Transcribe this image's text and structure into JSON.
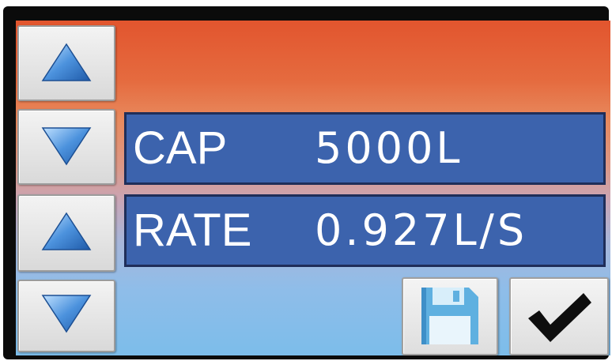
{
  "controls": {
    "up_icon": "triangle-up-icon",
    "down_icon": "triangle-down-icon",
    "save_icon": "floppy-disk-icon",
    "confirm_icon": "checkmark-icon"
  },
  "fields": [
    {
      "label": "CAP",
      "value": "5000L"
    },
    {
      "label": "RATE",
      "value": "0.927L/S"
    }
  ],
  "colors": {
    "field_bg": "#3c63ad",
    "field_text": "#ffffff",
    "arrow_blue": "#3f86d6",
    "screen_top": "#e2552e",
    "screen_bottom": "#7cbdea"
  }
}
